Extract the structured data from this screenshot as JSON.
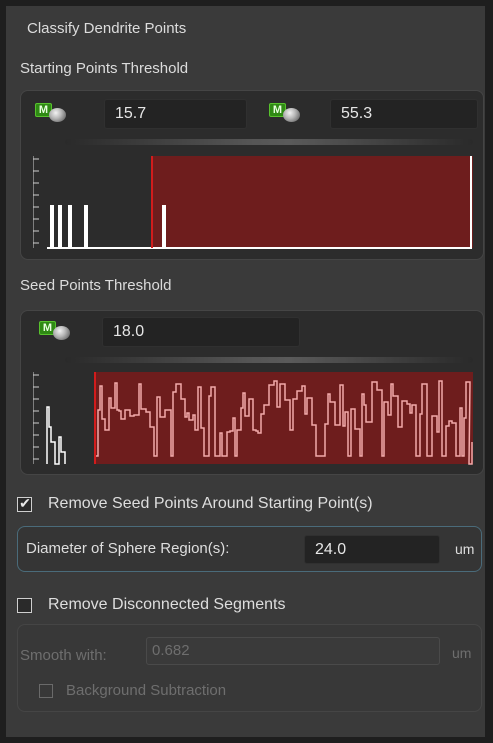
{
  "panel": {
    "title": "Classify Dendrite Points"
  },
  "starting_points": {
    "label": "Starting Points Threshold",
    "low_value": "15.7",
    "high_value": "55.3",
    "high_fraction": 0.27
  },
  "seed_points": {
    "label": "Seed Points Threshold",
    "value": "18.0",
    "threshold_fraction": 0.1
  },
  "remove_seed": {
    "checked": true,
    "label": "Remove Seed Points Around Starting Point(s)",
    "diameter_label": "Diameter of Sphere Region(s):",
    "diameter_value": "24.0",
    "unit": "um"
  },
  "remove_disconnected": {
    "checked": false,
    "label": "Remove Disconnected Segments",
    "smooth_label": "Smooth with:",
    "smooth_value": "0.682",
    "unit": "um",
    "background_subtraction_label": "Background Subtraction"
  },
  "icons": {
    "mode_button": "m-disc-icon",
    "checkbox_tick": "check-icon"
  },
  "colors": {
    "selection_red": "#6e1d1d",
    "threshold_line": "#d21c1c",
    "histogram_line": "#ffffff",
    "histogram_selected": "#f2aaaa",
    "focus_border": "#4a6b7a"
  }
}
